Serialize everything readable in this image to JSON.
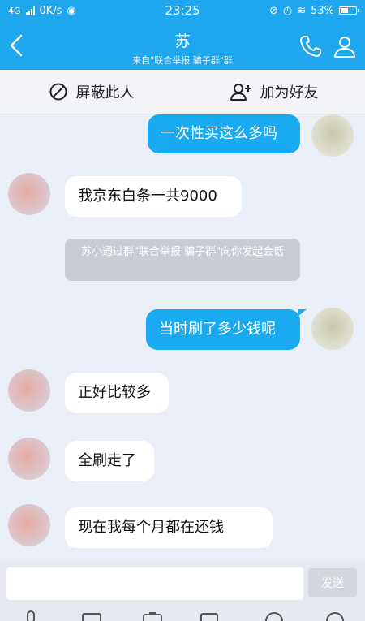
{
  "status": {
    "network": "4G",
    "speed": "0K/s",
    "time": "23:25",
    "battery": "53%",
    "battery_level": 0.53
  },
  "header": {
    "title": "苏",
    "subtitle": "来自\"联合举报 骗子群\"群"
  },
  "actions": {
    "block": "屏蔽此人",
    "add_friend": "加为好友"
  },
  "messages": [
    {
      "side": "out",
      "text": "一次性买这么多吗"
    },
    {
      "side": "in",
      "text": "我京东白条一共9000"
    },
    {
      "side": "system",
      "text": "苏小通过群\"联合举报 骗子群\"向你发起会话"
    },
    {
      "side": "out",
      "text": "当时刷了多少钱呢"
    },
    {
      "side": "in",
      "text": "正好比较多"
    },
    {
      "side": "in",
      "text": "全刷走了"
    },
    {
      "side": "in",
      "text": "现在我每个月都在还钱"
    }
  ],
  "input": {
    "value": "",
    "send_label": "发送"
  },
  "icons": [
    "back-icon",
    "phone-icon",
    "person-icon",
    "block-icon",
    "add-friend-icon"
  ],
  "colors": {
    "accent": "#1ea6ef",
    "outgoing_bubble": "#1aaaf2",
    "incoming_bubble": "#ffffff",
    "background": "#eaeef6"
  }
}
